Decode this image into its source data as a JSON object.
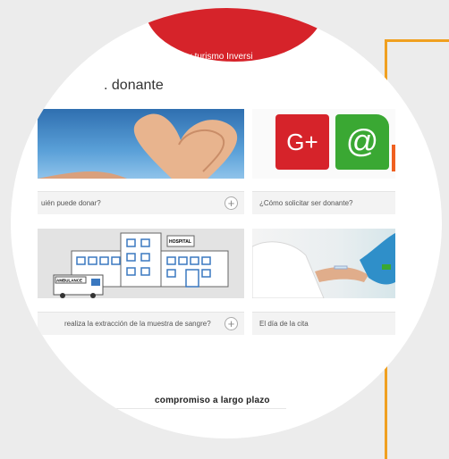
{
  "nav": {
    "partial_text": "ultura y turismo   Inversi"
  },
  "section": {
    "title": ". donante"
  },
  "cards": [
    {
      "caption": "uién puede donar?",
      "has_plus": true
    },
    {
      "caption": "¿Cómo solicitar ser donante?",
      "has_plus": false
    },
    {
      "caption": "realiza la extracción de la muestra de sangre?",
      "has_plus": true
    },
    {
      "caption": "El día de la cita",
      "has_plus": false
    }
  ],
  "illustrations": {
    "gplus_text": "G+",
    "at_text": "@",
    "hospital_sign": "HOSPITAL",
    "ambulance_text": "AMBULANCE"
  },
  "footer": {
    "text": "compromiso a largo plazo"
  },
  "colors": {
    "accent_red": "#d6232a",
    "orange_frame": "#f0a020",
    "gplus": "#d6232a",
    "email": "#3aa833"
  }
}
